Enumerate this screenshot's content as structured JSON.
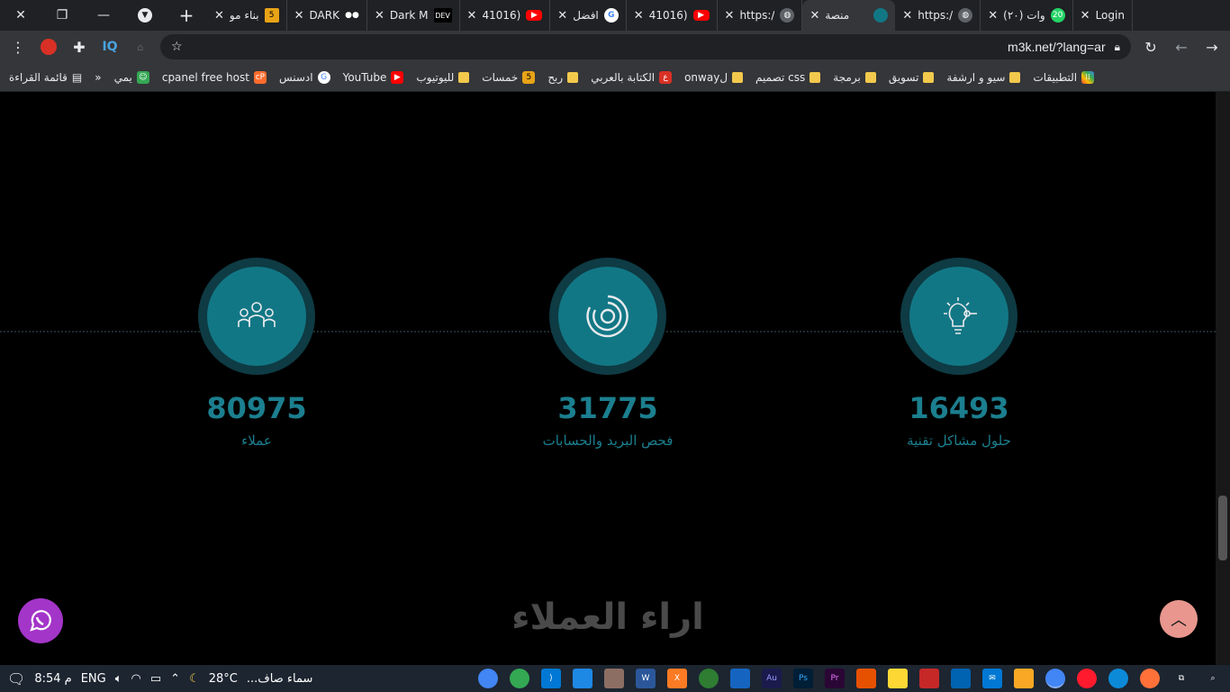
{
  "tabs": [
    {
      "label": "بناء مو",
      "icon": "five-icon",
      "color": "#e8a317"
    },
    {
      "label": "DARK",
      "icon": "medium-icon",
      "color": "#000000"
    },
    {
      "label": "Dark M",
      "icon": "dev-icon",
      "color": "#000000"
    },
    {
      "label": "41016)",
      "icon": "youtube-icon",
      "color": "#ff0000"
    },
    {
      "label": "افضل",
      "icon": "google-icon",
      "color": "#ffffff"
    },
    {
      "label": "41016)",
      "icon": "youtube-icon",
      "color": "#ff0000"
    },
    {
      "label": "https:/",
      "icon": "globe-icon",
      "color": "#5f6368"
    },
    {
      "label": "منصة",
      "icon": "site-icon",
      "color": "#127785"
    },
    {
      "label": "https:/",
      "icon": "globe-icon",
      "color": "#5f6368"
    },
    {
      "label": "(٢٠) وات",
      "icon": "whatsapp-icon",
      "color": "#25d366"
    },
    {
      "label": "Login",
      "icon": "login-icon",
      "color": "#5f6368"
    }
  ],
  "toolbar": {
    "url": "m3k.net/?lang=ar",
    "iq": "IQ"
  },
  "bookmarks": [
    "قائمة القراءة",
    "»",
    "يمي",
    "cpanel free host",
    "ادسنس",
    "YouTube",
    "لليوتيوب",
    "خمسات",
    "ربح",
    "الكتابة بالعربي",
    "onwayل",
    "تصميم css",
    "برمجة",
    "تسويق",
    "سيو و ارشفة",
    "التطبيقات"
  ],
  "stats": [
    {
      "value": "80975",
      "label": "عملاء",
      "icon": "users-icon"
    },
    {
      "value": "31775",
      "label": "فحص البريد والحسابات",
      "icon": "scan-icon"
    },
    {
      "value": "16493",
      "label": "حلول مشاكل تقنية",
      "icon": "lightbulb-icon"
    }
  ],
  "section": {
    "title": "اراء العملاء"
  },
  "taskbar": {
    "time": "8:54 م",
    "lang": "ENG",
    "temp": "28°C",
    "weather": "سماء صاف..."
  },
  "colors": {
    "accent": "#127785",
    "number": "#1b7f8f",
    "whatsapp": "#a335c8",
    "totop": "#e8968e"
  }
}
